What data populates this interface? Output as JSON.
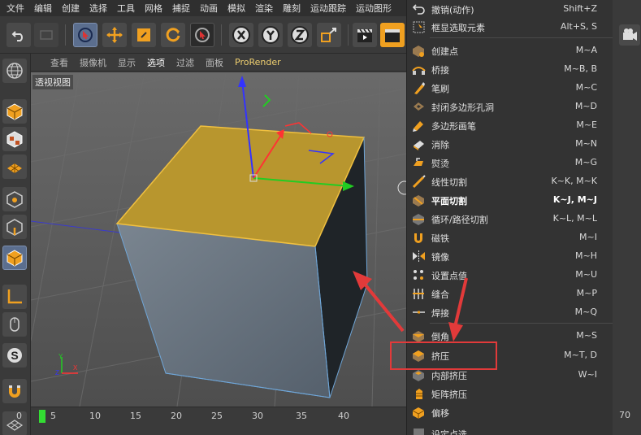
{
  "menubar": {
    "items": [
      "文件",
      "编辑",
      "创建",
      "选择",
      "工具",
      "网格",
      "捕捉",
      "动画",
      "模拟",
      "渲染",
      "雕刻",
      "运动跟踪",
      "运动图形"
    ]
  },
  "viewport_header": {
    "items": [
      "查看",
      "摄像机",
      "显示",
      "选项",
      "过滤",
      "面板",
      "ProRender"
    ],
    "active": "选项"
  },
  "viewport": {
    "label": "透视视图"
  },
  "timeline": {
    "ticks": [
      "0",
      "5",
      "10",
      "15",
      "20",
      "25",
      "30",
      "35",
      "40",
      "70"
    ]
  },
  "context_menu": {
    "items": [
      {
        "label": "撤销(动作)",
        "shortcut": "Shift+Z"
      },
      {
        "label": "框显选取元素",
        "shortcut": "Alt+S, S"
      },
      {
        "label": "创建点",
        "shortcut": "M~A"
      },
      {
        "label": "桥接",
        "shortcut": "M~B, B"
      },
      {
        "label": "笔刷",
        "shortcut": "M~C"
      },
      {
        "label": "封闭多边形孔洞",
        "shortcut": "M~D"
      },
      {
        "label": "多边形画笔",
        "shortcut": "M~E"
      },
      {
        "label": "消除",
        "shortcut": "M~N"
      },
      {
        "label": "熨烫",
        "shortcut": "M~G"
      },
      {
        "label": "线性切割",
        "shortcut": "K~K, M~K"
      },
      {
        "label": "平面切割",
        "shortcut": "K~J, M~J"
      },
      {
        "label": "循环/路径切割",
        "shortcut": "K~L, M~L"
      },
      {
        "label": "磁铁",
        "shortcut": "M~I"
      },
      {
        "label": "镜像",
        "shortcut": "M~H"
      },
      {
        "label": "设置点值",
        "shortcut": "M~U"
      },
      {
        "label": "缝合",
        "shortcut": "M~P"
      },
      {
        "label": "焊接",
        "shortcut": "M~Q"
      },
      {
        "label": "倒角",
        "shortcut": "M~S"
      },
      {
        "label": "挤压",
        "shortcut": "M~T, D"
      },
      {
        "label": "内部挤压",
        "shortcut": "W~I"
      },
      {
        "label": "矩阵挤压",
        "shortcut": ""
      },
      {
        "label": "偏移",
        "shortcut": ""
      },
      {
        "label": "设定点选...",
        "shortcut": ""
      }
    ]
  },
  "colors": {
    "accent_selected": "#5b6e8e",
    "top_face": "#b8962e",
    "highlight_red": "#e23a3a"
  }
}
